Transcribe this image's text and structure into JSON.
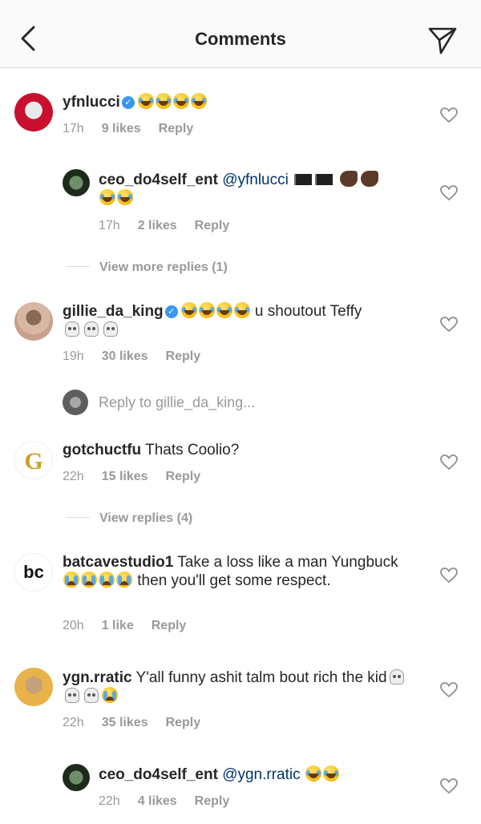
{
  "header": {
    "title": "Comments"
  },
  "comments": [
    {
      "user": "yfnlucci",
      "verified": true,
      "time": "17h",
      "likes": "9 likes",
      "reply": "Reply"
    },
    {
      "user": "ceo_do4self_ent",
      "mention": "@yfnlucci",
      "time": "17h",
      "likes": "2 likes",
      "reply": "Reply"
    },
    {
      "view_more": "View more replies (1)"
    },
    {
      "user": "gillie_da_king",
      "verified": true,
      "text": " u shoutout Teffy",
      "time": "19h",
      "likes": "30 likes",
      "reply": "Reply"
    },
    {
      "reply_to": "Reply to gillie_da_king..."
    },
    {
      "user": "gotchuctfu",
      "text": " Thats Coolio?",
      "time": "22h",
      "likes": "15 likes",
      "reply": "Reply"
    },
    {
      "view_more": "View replies (4)"
    },
    {
      "user": "batcavestudio1",
      "avatar_text": "bc",
      "text_a": " Take a loss like a man Yungbuck ",
      "text_b": " then you'll get some respect.",
      "time": "20h",
      "likes": "1 like",
      "reply": "Reply"
    },
    {
      "user": "ygn.rratic",
      "text": " Y'all funny ashit talm bout rich the kid",
      "time": "22h",
      "likes": "35 likes",
      "reply": "Reply"
    },
    {
      "user": "ceo_do4self_ent",
      "mention": "@ygn.rratic",
      "time": "22h",
      "likes": "4 likes",
      "reply": "Reply"
    }
  ],
  "colors": {
    "accent_blue": "#3897f0",
    "mention": "#003569",
    "meta_gray": "#999999"
  }
}
